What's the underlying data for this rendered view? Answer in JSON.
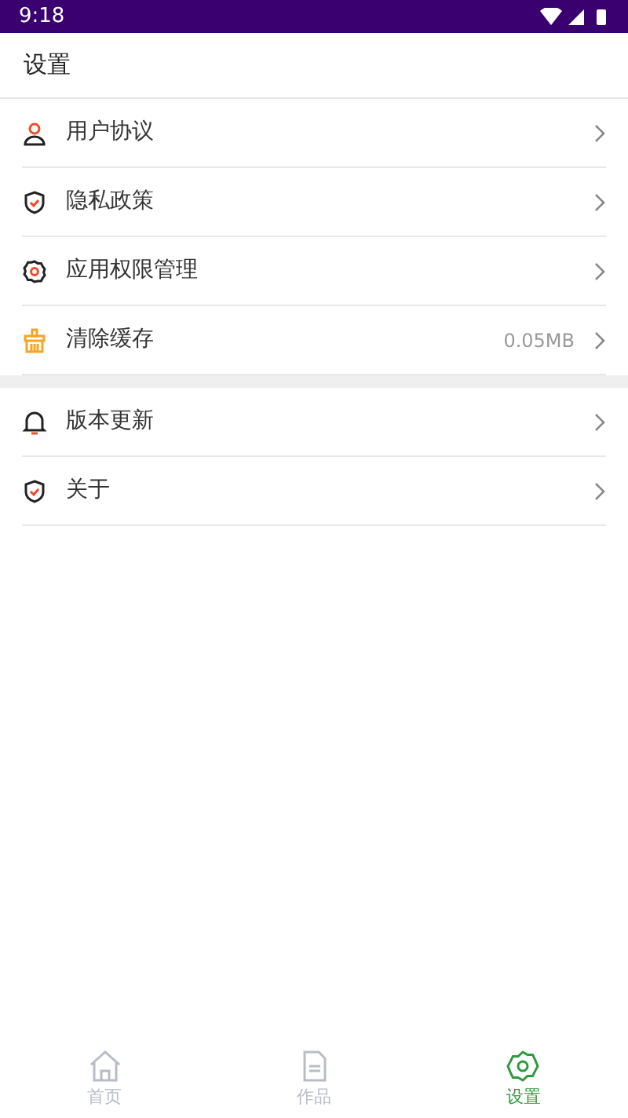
{
  "status_bar": {
    "time": "9:18"
  },
  "header": {
    "title": "设置"
  },
  "groups": [
    {
      "items": [
        {
          "kind": "person",
          "label": "用户协议"
        },
        {
          "kind": "shield",
          "label": "隐私政策"
        },
        {
          "kind": "gear",
          "label": "应用权限管理"
        },
        {
          "kind": "broom",
          "label": "清除缓存",
          "value": "0.05MB"
        }
      ]
    },
    {
      "items": [
        {
          "kind": "bell",
          "label": "版本更新"
        },
        {
          "kind": "shield",
          "label": "关于"
        }
      ]
    }
  ],
  "tabs": [
    {
      "kind": "home",
      "label": "首页",
      "selected": false
    },
    {
      "kind": "file",
      "label": "作品",
      "selected": false
    },
    {
      "kind": "gear",
      "label": "设置",
      "selected": true
    }
  ]
}
